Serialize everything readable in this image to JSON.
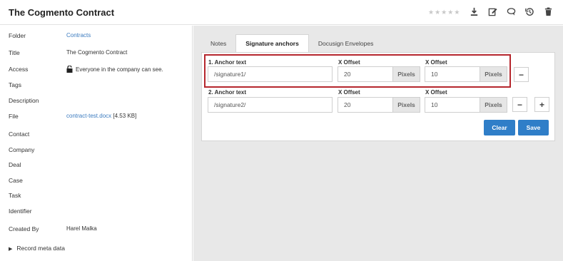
{
  "header": {
    "title": "The Cogmento Contract",
    "stars": [
      "★",
      "★",
      "★",
      "★",
      "★"
    ],
    "icons": [
      "download-icon",
      "edit-icon",
      "comment-icon",
      "history-icon",
      "trash-icon"
    ]
  },
  "details": {
    "folder_label": "Folder",
    "folder_value": "Contracts",
    "title_label": "Title",
    "title_value": "The Cogmento Contract",
    "access_label": "Access",
    "access_value": "Everyone in the company can see.",
    "tags_label": "Tags",
    "description_label": "Description",
    "file_label": "File",
    "file_name": "contract-test.docx",
    "file_size": "[4.53 KB]",
    "contact_label": "Contact",
    "company_label": "Company",
    "deal_label": "Deal",
    "case_label": "Case",
    "task_label": "Task",
    "identifier_label": "Identifier",
    "created_by_label": "Created By",
    "created_by_value": "Harel Malka",
    "meta_toggle": "Record meta data"
  },
  "tabs": [
    "Notes",
    "Signature anchors",
    "Docusign Envelopes"
  ],
  "anchors": [
    {
      "anchor_label": "1. Anchor text",
      "anchor_value": "/signature1/",
      "x_label": "X Offset",
      "x_value": "20",
      "x_unit": "Pixels",
      "y_label": "X Offset",
      "y_value": "10",
      "y_unit": "Pixels"
    },
    {
      "anchor_label": "2. Anchor text",
      "anchor_value": "/signature2/",
      "x_label": "X Offset",
      "x_value": "20",
      "x_unit": "Pixels",
      "y_label": "X Offset",
      "y_value": "10",
      "y_unit": "Pixels"
    }
  ],
  "buttons": {
    "minus": "−",
    "plus": "+",
    "clear": "Clear",
    "save": "Save"
  },
  "colors": {
    "accent": "#2f7ec8",
    "highlight": "#b5262d",
    "link": "#3b7bbf"
  }
}
